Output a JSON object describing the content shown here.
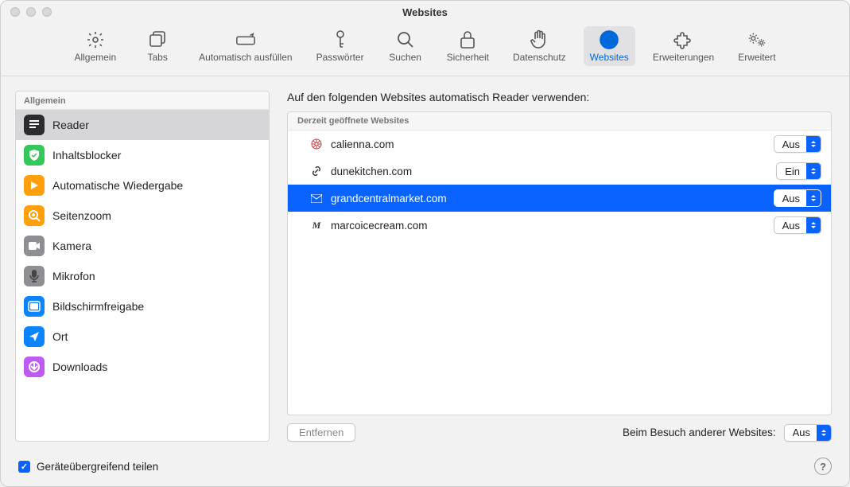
{
  "window_title": "Websites",
  "toolbar": [
    {
      "label": "Allgemein",
      "icon": "gear-icon"
    },
    {
      "label": "Tabs",
      "icon": "tabs-icon"
    },
    {
      "label": "Automatisch ausfüllen",
      "icon": "autofill-icon"
    },
    {
      "label": "Passwörter",
      "icon": "key-icon"
    },
    {
      "label": "Suchen",
      "icon": "search-icon"
    },
    {
      "label": "Sicherheit",
      "icon": "lock-icon"
    },
    {
      "label": "Datenschutz",
      "icon": "hand-icon"
    },
    {
      "label": "Websites",
      "icon": "globe-icon",
      "active": true
    },
    {
      "label": "Erweiterungen",
      "icon": "puzzle-icon"
    },
    {
      "label": "Erweitert",
      "icon": "gears-icon"
    }
  ],
  "sidebar": {
    "header": "Allgemein",
    "items": [
      {
        "label": "Reader",
        "icon": "reader-icon",
        "bg": "#2c2c2e",
        "selected": true
      },
      {
        "label": "Inhaltsblocker",
        "icon": "shield-check-icon",
        "bg": "#34c759"
      },
      {
        "label": "Automatische Wiedergabe",
        "icon": "play-icon",
        "bg": "#ff9f0a"
      },
      {
        "label": "Seitenzoom",
        "icon": "zoom-icon",
        "bg": "#ff9f0a"
      },
      {
        "label": "Kamera",
        "icon": "camera-icon",
        "bg": "#8e8e93"
      },
      {
        "label": "Mikrofon",
        "icon": "mic-icon",
        "bg": "#8e8e93"
      },
      {
        "label": "Bildschirmfreigabe",
        "icon": "screenshare-icon",
        "bg": "#0a84ff"
      },
      {
        "label": "Ort",
        "icon": "location-icon",
        "bg": "#0a84ff"
      },
      {
        "label": "Downloads",
        "icon": "download-icon",
        "bg": "#bf5af2"
      }
    ]
  },
  "main": {
    "heading": "Auf den folgenden Websites automatisch Reader verwenden:",
    "list_header": "Derzeit geöffnete Websites",
    "rows": [
      {
        "site": "calienna.com",
        "value": "Aus",
        "fav": "wheel",
        "selected": false
      },
      {
        "site": "dunekitchen.com",
        "value": "Ein",
        "fav": "link",
        "selected": false
      },
      {
        "site": "grandcentralmarket.com",
        "value": "Aus",
        "fav": "env",
        "selected": true
      },
      {
        "site": "marcoicecream.com",
        "value": "Aus",
        "fav": "m",
        "selected": false
      }
    ],
    "remove_button": "Entfernen",
    "other_label": "Beim Besuch anderer Websites:",
    "other_value": "Aus"
  },
  "footer": {
    "checkbox_label": "Geräteübergreifend teilen",
    "checkbox_checked": true
  }
}
